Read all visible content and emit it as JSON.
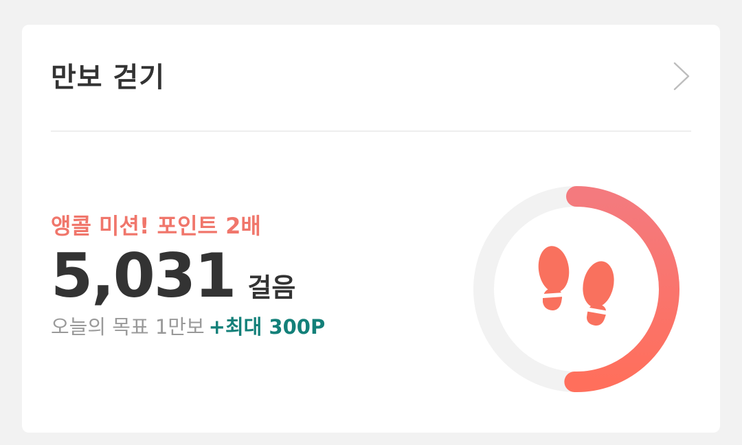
{
  "card": {
    "title": "만보 걷기",
    "icons": {
      "more": "chevron-right-icon",
      "center": "footprints-icon"
    }
  },
  "mission": {
    "label": "앵콜 미션! 포인트 2배"
  },
  "steps": {
    "count": "5,031",
    "unit": "걸음"
  },
  "goal": {
    "text": "오늘의 목표 1만보",
    "reward": "+최대 300P"
  },
  "progress": {
    "fraction": 0.5031,
    "color_start": "#f47a7e",
    "color_end": "#ff6f5c",
    "track_color": "#f2f2f2"
  }
}
